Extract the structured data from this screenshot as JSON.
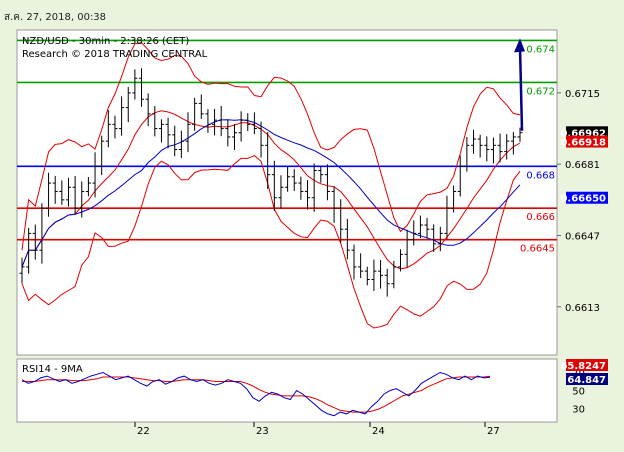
{
  "header": {
    "date": "ส.ค. 27, 2018, 00:38"
  },
  "chart_data": {
    "type": "candlestick",
    "title": "NZD/USD - 30min - 2:38:26 (CET)",
    "subtitle": "Research © 2018 TRADING CENTRAL",
    "ylim": [
      0.659,
      0.6745
    ],
    "yticks": [
      "0.6715",
      "0.6681",
      "0.6647",
      "0.6613"
    ],
    "xticks": [
      "22",
      "23",
      "24",
      "27"
    ],
    "levels": [
      {
        "label": "0.674",
        "value": 0.674,
        "color": "#00a000"
      },
      {
        "label": "0.672",
        "value": 0.672,
        "color": "#00a000"
      },
      {
        "label": "0.668",
        "value": 0.668,
        "color": "#0000ff"
      },
      {
        "label": "0.666",
        "value": 0.666,
        "color": "#e00000"
      },
      {
        "label": "0.6645",
        "value": 0.6645,
        "color": "#e00000"
      }
    ],
    "price_tags": [
      {
        "label": "0.66962",
        "value": 0.66962,
        "bg": "#000000",
        "fg": "#ffffff"
      },
      {
        "label": "0.66918",
        "value": 0.66918,
        "bg": "#e00000",
        "fg": "#ffffff"
      },
      {
        "label": "0.66650",
        "value": 0.6665,
        "bg": "#0000ff",
        "fg": "#ffffff"
      }
    ],
    "price_path": [
      0.6632,
      0.6648,
      0.664,
      0.666,
      0.6672,
      0.6668,
      0.6664,
      0.667,
      0.666,
      0.6668,
      0.6672,
      0.668,
      0.6692,
      0.67,
      0.6698,
      0.6708,
      0.6715,
      0.6722,
      0.6712,
      0.6705,
      0.6698,
      0.67,
      0.6695,
      0.6688,
      0.6692,
      0.67,
      0.671,
      0.6705,
      0.67,
      0.6702,
      0.6698,
      0.6694,
      0.6696,
      0.6702,
      0.67,
      0.6698,
      0.669,
      0.6676,
      0.6665,
      0.667,
      0.6675,
      0.6672,
      0.6668,
      0.6665,
      0.6678,
      0.6676,
      0.6668,
      0.666,
      0.665,
      0.664,
      0.6632,
      0.663,
      0.6626,
      0.663,
      0.6628,
      0.6624,
      0.6632,
      0.6638,
      0.6645,
      0.6648,
      0.6652,
      0.665,
      0.6643,
      0.6648,
      0.666,
      0.6668,
      0.668,
      0.669,
      0.6693,
      0.669,
      0.6688,
      0.669,
      0.6687,
      0.6692,
      0.6694,
      0.6696
    ],
    "rsi": {
      "label": "RSI14 - 9MA",
      "ylim": [
        15,
        85
      ],
      "yticks": [
        "70",
        "50",
        "30"
      ],
      "tags": [
        {
          "label": "65.8247",
          "value": 65.8247,
          "bg": "#e00000",
          "fg": "#ffffff"
        },
        {
          "label": "64.847",
          "value": 64.847,
          "bg": "#000080",
          "fg": "#ffffff"
        }
      ],
      "rsi_path": [
        62,
        58,
        60,
        64,
        66,
        63,
        60,
        62,
        58,
        60,
        63,
        66,
        68,
        70,
        66,
        62,
        64,
        66,
        62,
        58,
        55,
        60,
        62,
        57,
        60,
        64,
        66,
        62,
        60,
        62,
        58,
        56,
        58,
        62,
        60,
        58,
        52,
        42,
        38,
        44,
        48,
        46,
        42,
        40,
        50,
        46,
        40,
        34,
        28,
        24,
        22,
        26,
        24,
        28,
        26,
        24,
        32,
        38,
        46,
        50,
        52,
        48,
        44,
        50,
        58,
        62,
        66,
        70,
        68,
        64,
        62,
        66,
        62,
        66,
        64,
        64.8
      ],
      "ma_path": [
        60,
        60,
        60,
        61,
        62,
        62,
        62,
        62,
        61,
        61,
        61,
        62,
        63,
        65,
        65,
        65,
        65,
        65,
        64,
        63,
        62,
        61,
        61,
        60,
        60,
        61,
        62,
        62,
        62,
        62,
        61,
        60,
        60,
        60,
        60,
        60,
        58,
        55,
        51,
        48,
        46,
        45,
        44,
        44,
        44,
        44,
        43,
        41,
        38,
        34,
        31,
        28,
        27,
        26,
        26,
        26,
        27,
        29,
        32,
        36,
        40,
        44,
        46,
        48,
        50,
        54,
        57,
        60,
        63,
        64,
        65,
        65,
        65,
        65,
        65,
        65.8
      ]
    }
  }
}
